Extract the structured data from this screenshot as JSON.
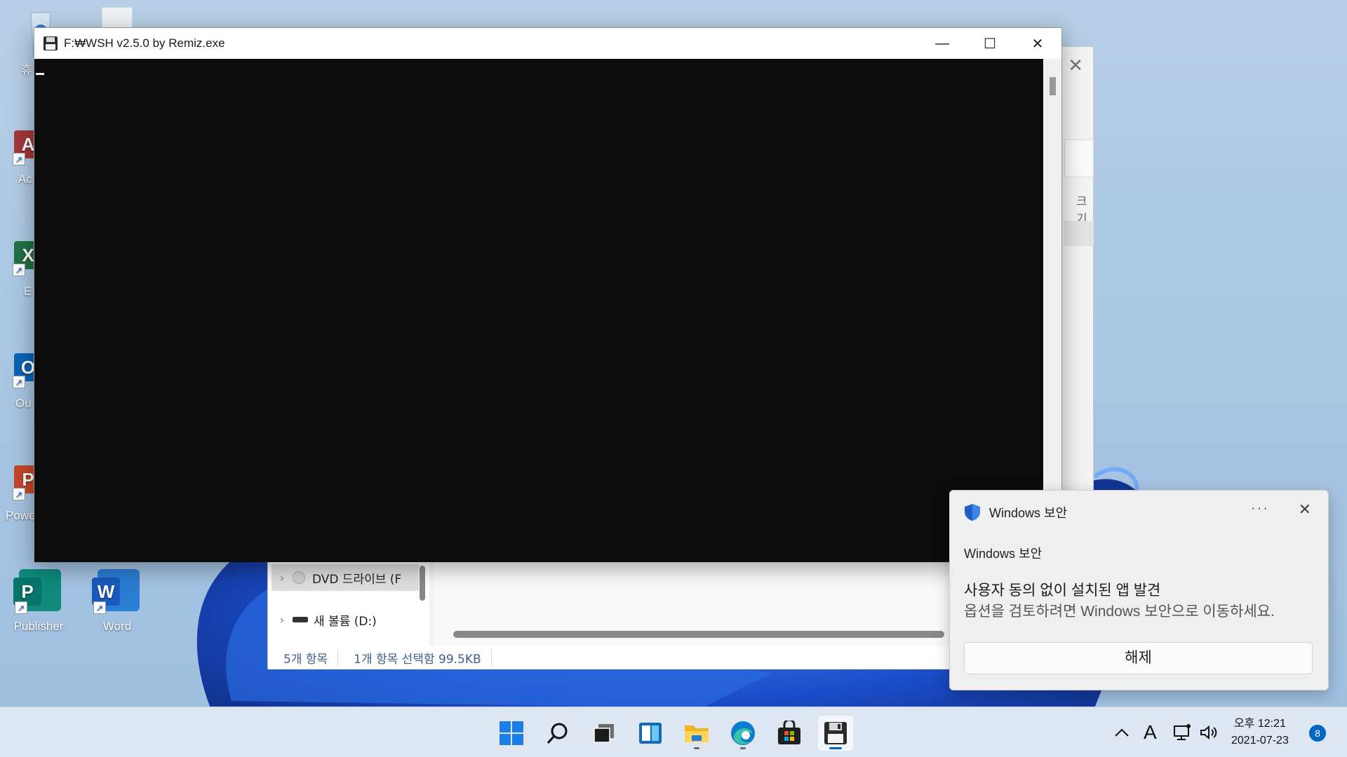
{
  "console": {
    "title": "F:₩WSH v2.5.0 by Remiz.exe",
    "minimize_glyph": "—",
    "maximize_glyph": "☐",
    "close_glyph": "✕"
  },
  "explorer": {
    "close_glyph": "✕",
    "size_column_label": "크기",
    "nav_items": [
      {
        "label": "DVD 드라이브 (F"
      },
      {
        "label": "새 볼륨 (D:)"
      }
    ],
    "status": {
      "item_count": "5개 항목",
      "selection": "1개 항목 선택함 99.5KB"
    }
  },
  "desktop": {
    "icons": [
      {
        "label": "휴",
        "icon": "recycle-bin-icon"
      },
      {
        "label": "Ac",
        "icon": "access-icon",
        "color": "#a4373a",
        "letter": "A"
      },
      {
        "label": "E",
        "icon": "excel-icon",
        "color": "#1f7244",
        "letter": "X"
      },
      {
        "label": "Ou",
        "icon": "outlook-icon",
        "color": "#0a64b4",
        "letter": "O"
      },
      {
        "label": "Powe",
        "icon": "powerpoint-icon",
        "color": "#c4462a",
        "letter": "P"
      },
      {
        "label": "Publisher",
        "icon": "publisher-icon",
        "color": "#077568",
        "letter": "P"
      },
      {
        "label": "Word",
        "icon": "word-icon",
        "color": "#185abd",
        "letter": "W"
      }
    ]
  },
  "toast": {
    "app_name": "Windows 보안",
    "more_glyph": "···",
    "close_glyph": "✕",
    "sender": "Windows 보안",
    "title": "사용자 동의 없이 설치된 앱 발견",
    "body": "옵션을 검토하려면 Windows 보안으로 이동하세요.",
    "action_label": "해제"
  },
  "taskbar": {
    "apps": [
      "start-icon",
      "search-icon",
      "task-view-icon",
      "widgets-icon",
      "file-explorer-icon",
      "edge-icon",
      "store-icon",
      "floppy-app-icon"
    ],
    "tray": {
      "chevron": "^",
      "ime": "A"
    },
    "clock": {
      "time": "오후 12:21",
      "date": "2021-07-23"
    },
    "notification_count": "8",
    "accent": "#0067c0"
  }
}
